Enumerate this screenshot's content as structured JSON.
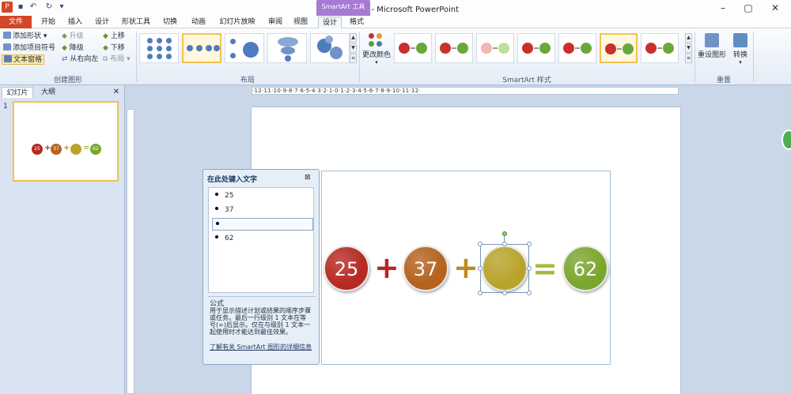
{
  "window": {
    "title": "演示文稿1 - Microsoft PowerPoint",
    "min": "–",
    "max": "▢",
    "close": "✕"
  },
  "quick_access": {
    "save": "▪",
    "undo": "↶",
    "redo": "↻",
    "more": "▾"
  },
  "tabs": [
    "文件",
    "开始",
    "插入",
    "设计",
    "形状工具",
    "切换",
    "动画",
    "幻灯片放映",
    "审阅",
    "视图",
    "设计",
    "格式"
  ],
  "context_tab": "SmartArt 工具",
  "ribbon": {
    "create_group": {
      "label": "创建图形",
      "add_shape": "添加形状 ▾",
      "add_bullet": "添加项目符号",
      "text_pane": "文本窗格",
      "promote": "升级",
      "demote": "降级",
      "rtl": "从右向左",
      "move_up": "上移",
      "move_down": "下移",
      "layout": "布局 ▾"
    },
    "layout_group": {
      "label": "布局"
    },
    "styles_group": {
      "label": "SmartArt 样式",
      "change_colors": "更改颜色"
    },
    "reset_group": {
      "label": "重置",
      "reset_graphic": "重设图形",
      "convert": "转换"
    }
  },
  "left_pane": {
    "tab_slides": "幻灯片",
    "tab_outline": "大纲",
    "close": "✕",
    "slide_number": "1",
    "thumb_values": [
      "25",
      "37",
      "62"
    ]
  },
  "ruler_text": "·12·11·10·9·8·7·6·5·4·3·2·1·0·1·2·3·4·5·6·7·8·9·10·11·12·",
  "text_pane": {
    "title": "在此处键入文字",
    "close": "⊠",
    "items": [
      "25",
      "37",
      "",
      "62"
    ],
    "desc_title": "公式",
    "desc": "用于显示描述计划或结果的顺序步骤或任务。最后一行级别 1 文本在等号(=)后显示。仅在与级别 1 文本一起使用时才能达到最佳效果。",
    "link": "了解有关 SmartArt 图形的详细信息"
  },
  "smartart": {
    "values": [
      "25",
      "37",
      "",
      "62"
    ],
    "operators": [
      "+",
      "+",
      "="
    ],
    "colors": {
      "c1": "#b62a22",
      "c2": "#b4621e",
      "c3": "#b8a32c",
      "c4": "#7ba62c",
      "op1": "#b8262a",
      "op2": "#c08a1e",
      "op_eq": "#9cbc3a"
    }
  }
}
